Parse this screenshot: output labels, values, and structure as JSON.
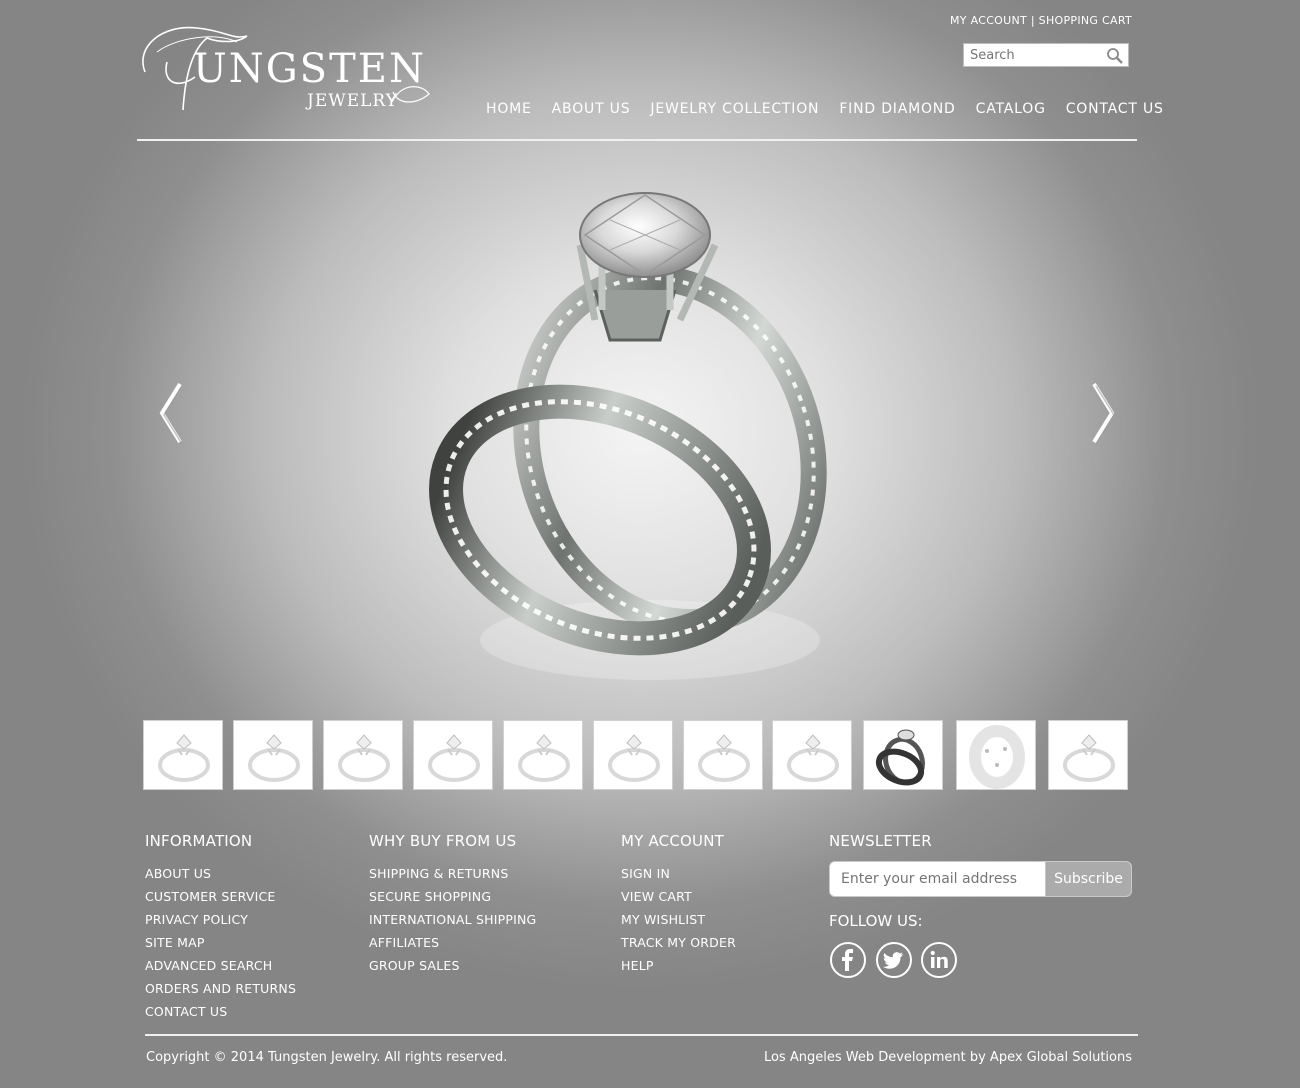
{
  "brand": {
    "name_big": "UNGSTEN",
    "name_small": "JEWELRY",
    "initial": "T"
  },
  "toplinks": {
    "account": "MY ACCOUNT",
    "separator": "|",
    "cart": "SHOPPING CART"
  },
  "search": {
    "placeholder": "Search",
    "icon": "search-icon"
  },
  "nav": [
    {
      "label": "HOME"
    },
    {
      "label": "ABOUT US"
    },
    {
      "label": "JEWELRY COLLECTION"
    },
    {
      "label": "FIND DIAMOND"
    },
    {
      "label": "CATALOG"
    },
    {
      "label": "CONTACT US"
    }
  ],
  "slider": {
    "prev_icon": "chevron-left-icon",
    "next_icon": "chevron-right-icon",
    "thumbnail_count": 11,
    "active_thumbnail": 9
  },
  "footer": {
    "information": {
      "title": "INFORMATION",
      "items": [
        "ABOUT US",
        "CUSTOMER SERVICE",
        "PRIVACY POLICY",
        "SITE MAP",
        "ADVANCED SEARCH",
        "ORDERS AND RETURNS",
        "CONTACT US"
      ]
    },
    "why_buy": {
      "title": "WHY BUY FROM US",
      "items": [
        "SHIPPING & RETURNS",
        "SECURE SHOPPING",
        "INTERNATIONAL SHIPPING",
        "AFFILIATES",
        "GROUP SALES"
      ]
    },
    "my_account": {
      "title": "MY ACCOUNT",
      "items": [
        "SIGN IN",
        "VIEW CART",
        "MY WISHLIST",
        "TRACK MY ORDER",
        "HELP"
      ]
    },
    "newsletter": {
      "title": "NEWSLETTER",
      "placeholder": "Enter your email address",
      "button": "Subscribe",
      "follow_label": "FOLLOW US:",
      "social": [
        "facebook-icon",
        "twitter-icon",
        "linkedin-icon"
      ]
    }
  },
  "copyright": "Copyright © 2014 Tungsten Jewelry. All rights reserved.",
  "credit": "Los Angeles Web Development by Apex Global Solutions"
}
